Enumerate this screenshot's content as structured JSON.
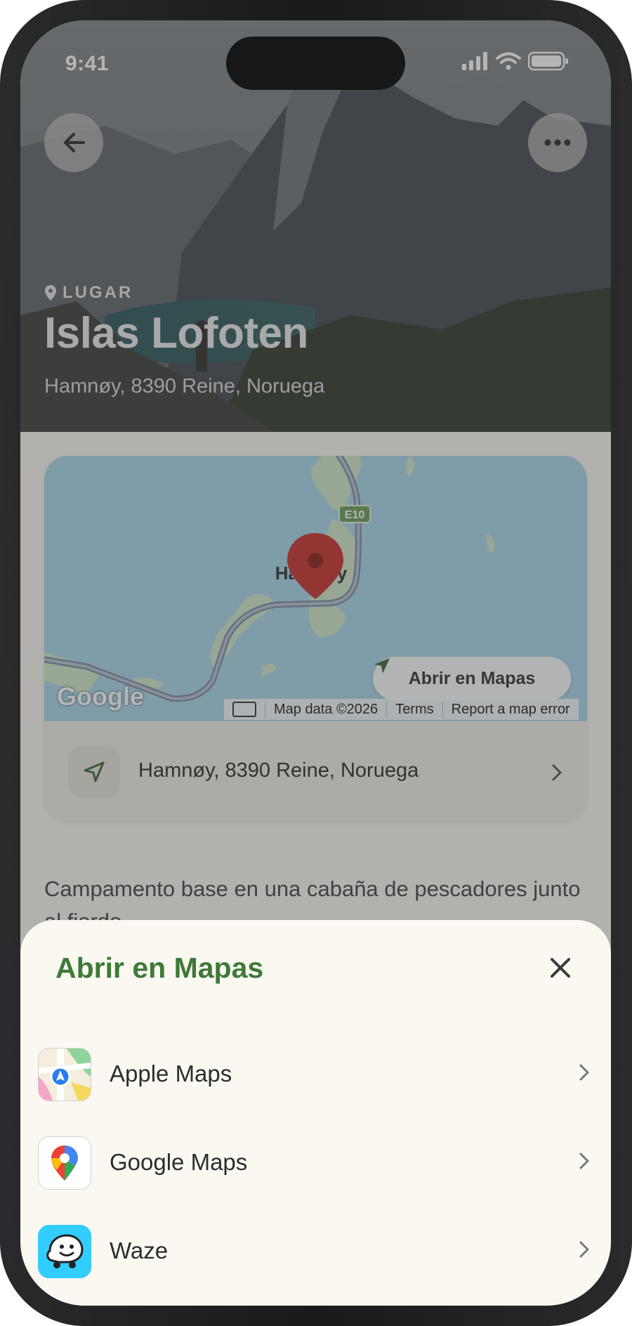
{
  "status_bar": {
    "time": "9:41"
  },
  "header": {
    "tag_label": "LUGAR",
    "title": "Islas Lofoten",
    "address": "Hamnøy, 8390 Reine, Noruega"
  },
  "map": {
    "place_label": "Hamnøy",
    "road_label": "E10",
    "open_button_label": "Abrir en Mapas",
    "logo_text": "Google",
    "attribution": [
      "Map data ©2026",
      "Terms",
      "Report a map error"
    ]
  },
  "address_row": {
    "text": "Hamnøy, 8390 Reine, Noruega"
  },
  "description": "Campamento base en una cabaña de pescadores junto al fiordo.",
  "sheet": {
    "title": "Abrir en Mapas",
    "apps": [
      {
        "name": "Apple Maps",
        "icon": "apple-maps-icon"
      },
      {
        "name": "Google Maps",
        "icon": "google-maps-icon"
      },
      {
        "name": "Waze",
        "icon": "waze-icon"
      }
    ]
  },
  "colors": {
    "accent_green": "#3e7a37",
    "sheet_bg": "#fbf8f2",
    "pin_red": "#c8332e"
  }
}
